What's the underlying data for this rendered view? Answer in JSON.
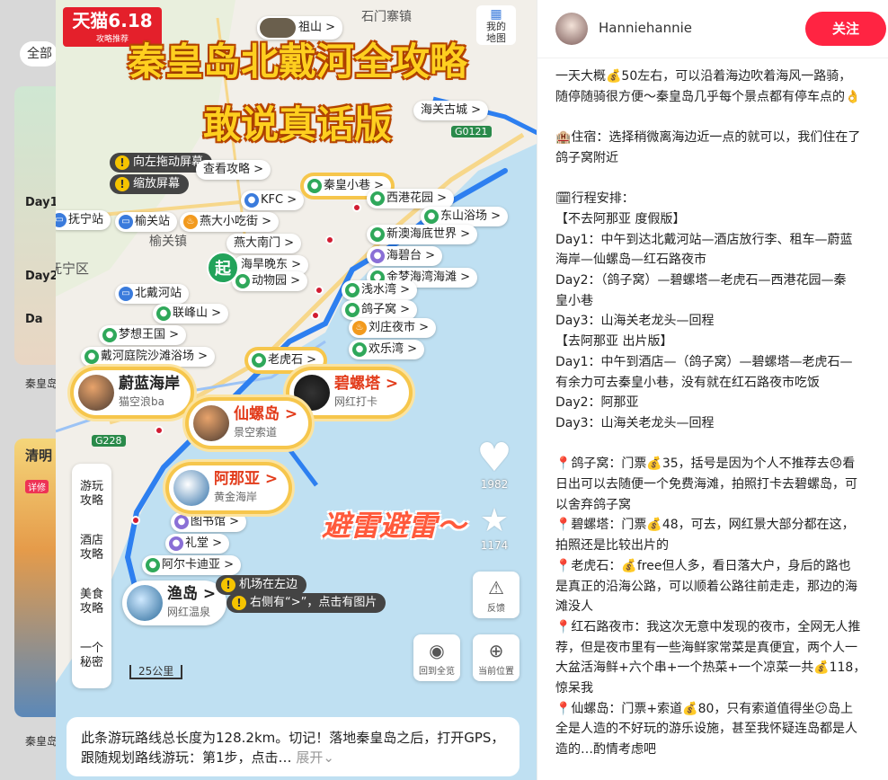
{
  "background": {
    "chip_label": "全部",
    "day_labels": [
      "Day1",
      "Day2",
      "Da"
    ],
    "caption1": "秦皇岛",
    "caption2": "清明",
    "caption3": "秦皇岛",
    "caption2_sub": "详修"
  },
  "post": {
    "badge_brand": "天猫6.18",
    "badge_sub": "攻略推荐",
    "title_line1": "秦皇岛北戴河全攻略",
    "title_line2": "敢说真话版",
    "map": {
      "top_labels": {
        "zushan": "祖山 >",
        "shimenzhai": "石门寨镇",
        "my_map": "我的\n地图",
        "haiguan": "海关古城 >",
        "g0121": "G0121"
      },
      "warnings": [
        "向左拖动屏幕",
        "缩放屏幕",
        "机场在左边",
        "右侧有“>”，点击有图片"
      ],
      "view_guide": "查看攻略 >",
      "pois": [
        {
          "label": "KFC >",
          "icon": "pin",
          "color": "blue"
        },
        {
          "label": "秦皇小巷 >",
          "icon": "pin",
          "color": "green"
        },
        {
          "label": "西港花园 >",
          "icon": "pin",
          "color": "green"
        },
        {
          "label": "东山浴场 >",
          "icon": "pin",
          "color": "green"
        },
        {
          "label": "新澳海底世界 >",
          "icon": "pin",
          "color": "green"
        },
        {
          "label": "海碧台 >",
          "icon": "pin",
          "color": "purple"
        },
        {
          "label": "金梦海湾海滩 >",
          "icon": "pin",
          "color": "green"
        },
        {
          "label": "浅水湾 >",
          "icon": "pin",
          "color": "green"
        },
        {
          "label": "鸽子窝 >",
          "icon": "pin",
          "color": "green"
        },
        {
          "label": "刘庄夜市 >",
          "icon": "fork",
          "color": "orange"
        },
        {
          "label": "欢乐湾 >",
          "icon": "pin",
          "color": "green"
        },
        {
          "label": "抚宁站",
          "icon": "train",
          "color": "blue"
        },
        {
          "label": "榆关站",
          "icon": "train",
          "color": "blue"
        },
        {
          "label": "燕大小吃街 >",
          "icon": "fork",
          "color": "orange"
        },
        {
          "label": "燕大南门 >",
          "icon": "pin",
          "color": "green"
        },
        {
          "label": "海旱晚东 >",
          "icon": "pin",
          "color": "green"
        },
        {
          "label": "动物园 >",
          "icon": "pin",
          "color": "green"
        },
        {
          "label": "北戴河站",
          "icon": "train",
          "color": "blue"
        },
        {
          "label": "联峰山 >",
          "icon": "pin",
          "color": "green"
        },
        {
          "label": "梦想王国 >",
          "icon": "pin",
          "color": "green"
        },
        {
          "label": "戴河庭院沙滩浴场 >",
          "icon": "pin",
          "color": "green"
        },
        {
          "label": "老虎石 >",
          "icon": "pin",
          "color": "green"
        },
        {
          "label": "图书馆 >",
          "icon": "pin",
          "color": "purple"
        },
        {
          "label": "礼堂 >",
          "icon": "pin",
          "color": "purple"
        },
        {
          "label": "阿尔卡迪亚 >",
          "icon": "pin",
          "color": "green"
        }
      ],
      "highlights": [
        {
          "title": "蔚蓝海岸",
          "sub": "猫空浪ba"
        },
        {
          "title": "碧螺塔 >",
          "sub": "网红打卡"
        },
        {
          "title": "仙螺岛 >",
          "sub": "景空索道"
        },
        {
          "title": "阿那亚 >",
          "sub": "黄金海岸"
        },
        {
          "title": "渔岛 >",
          "sub": "网红温泉"
        }
      ],
      "place_names": {
        "funing": "抚宁区",
        "yuguan": "榆关镇",
        "haigang": "海港",
        "g228": "G228"
      },
      "start_marker": "起",
      "side_menu": [
        "游玩\n攻略",
        "酒店\n攻略",
        "美食\n攻略",
        "一个\n秘密"
      ],
      "scale": "25公里",
      "likes": "1982",
      "collects": "1174",
      "avoid_text": "避雷避雷～",
      "controls": {
        "feedback": "反馈",
        "overview": "回到全览",
        "location": "当前位置"
      },
      "bottom_text": "此条游玩路线总长度为128.2km。切记！落地秦皇岛之后，打开GPS，跟随规划路线游玩：第1步，点击…",
      "expand": "展开"
    }
  },
  "author": {
    "name": "Hanniehannie",
    "follow_label": "关注"
  },
  "note_lines": [
    "一天大概💰50左右，可以沿着海边吹着海风一路骑，",
    "随停随骑很方便～秦皇岛几乎每个景点都有停车点的👌",
    "",
    "🏨住宿：选择稍微离海边近一点的就可以，我们住在了",
    "鸽子窝附近",
    "",
    "🗓行程安排：",
    "【不去阿那亚 度假版】",
    "Day1：中午到达北戴河站—酒店放行李、租车—蔚蓝",
    "海岸—仙螺岛—红石路夜市",
    "Day2：（鸽子窝）—碧螺塔—老虎石—西港花园—秦",
    "皇小巷",
    "Day3：山海关老龙头—回程",
    "【去阿那亚 出片版】",
    "Day1：中午到酒店—（鸽子窝）—碧螺塔—老虎石—",
    "有余力可去秦皇小巷，没有就在红石路夜市吃饭",
    "Day2：阿那亚",
    "Day3：山海关老龙头—回程",
    "",
    "📍鸽子窝：门票💰35，括号是因为个人不推荐去😞看",
    "日出可以去随便一个免费海滩，拍照打卡去碧螺岛，可",
    "以舍弃鸽子窝",
    "📍碧螺塔：门票💰48，可去，网红景大部分都在这，",
    "拍照还是比较出片的",
    "📍老虎石：💰free但人多，看日落大户，身后的路也",
    "是真正的沿海公路，可以顺着公路往前走走，那边的海",
    "滩没人",
    "📍红石路夜市：我这次无意中发现的夜市，全网无人推",
    "荐，但是夜市里有一些海鲜家常菜是真便宜，两个人一",
    "大盆活海鲜+六个串+一个热菜+一个凉菜一共💰118，",
    "惊呆我",
    "📍仙螺岛：门票+索道💰80，只有索道值得坐😕岛上",
    "全是人造的不好玩的游乐设施，甚至我怀疑连岛都是人",
    "造的…酌情考虑吧"
  ],
  "colors": {
    "follow_bg": "#ff2442",
    "route": "#2d7ff0",
    "title": "#ffcf1f",
    "highlight_ring": "#f6c64c"
  }
}
